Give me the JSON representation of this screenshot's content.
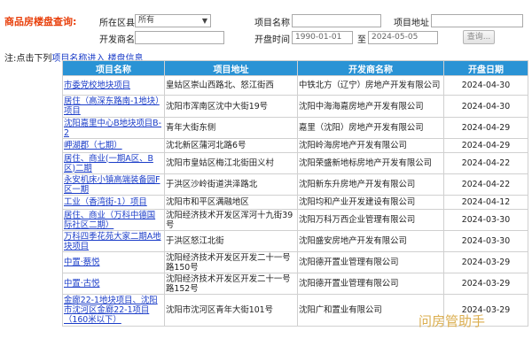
{
  "search": {
    "title": "商品房楼盘查询:",
    "district_label": "所在区县",
    "district_value": "所有",
    "project_name_label": "项目名称",
    "project_name_value": "",
    "project_addr_label": "项目地址",
    "project_addr_value": "",
    "developer_label": "开发商名",
    "developer_value": "",
    "open_time_label": "开盘时间",
    "date_from": "1990-01-01",
    "to_label": "至",
    "date_to": "2024-05-05",
    "query_button": "查询..."
  },
  "note": {
    "prefix": "注:点击下列",
    "link": "项目名称进入",
    "suffix": "楼盘信息"
  },
  "table": {
    "headers": [
      "项目名称",
      "项目地址",
      "开发商名称",
      "开盘日期"
    ],
    "rows": [
      {
        "name": "市委党校地块项目",
        "address": "皇姑区崇山西路北、怒江街西",
        "developer": "中铁北方（辽宁）房地产开发有限公司",
        "date": "2024-04-30"
      },
      {
        "name": "居住（高深东路南-1地块）项目",
        "address": "沈阳市浑南区沈中大街19号",
        "developer": "沈阳中海海嘉房地产开发有限公司",
        "date": "2024-04-30"
      },
      {
        "name": "沈阳嘉里中心B地块项目B-2",
        "address": "青年大街东侧",
        "developer": "嘉里（沈阳）房地产开发有限公司",
        "date": "2024-04-29"
      },
      {
        "name": "岬湖郡（七期）",
        "address": "沈北新区蒲河北路6号",
        "developer": "沈阳岭海房地产开发有限公司",
        "date": "2024-04-29"
      },
      {
        "name": "居住、商业(一期A区、B区)二期",
        "address": "沈阳市皇姑区梅江北街田义村",
        "developer": "沈阳荣盛新地标房地产开发有限公司",
        "date": "2024-04-22"
      },
      {
        "name": "永安机床小镇高端装备园F区一期",
        "address": "于洪区沙岭街道洪泽路北",
        "developer": "沈阳新东升房地产开发有限公司",
        "date": "2024-04-22"
      },
      {
        "name": "工业（香湾街-1）项目",
        "address": "沈阳市和平区满融地区",
        "developer": "沈阳均和产业开发建设有限公司",
        "date": "2024-04-12"
      },
      {
        "name": "居住、商业（万科中德国际社区二期）",
        "address": "沈阳经济技术开发区浑河十九街39号",
        "developer": "沈阳万科万西企业管理有限公司",
        "date": "2024-03-30"
      },
      {
        "name": "万科四季花苑大家二期A地块项目",
        "address": "于洪区怒江北街",
        "developer": "沈阳盛安房地产开发有限公司",
        "date": "2024-03-30"
      },
      {
        "name": "中置·蔡悦",
        "address": "沈阳经济技术开发区开发二十一号路150号",
        "developer": "沈阳德开置业管理有限公司",
        "date": "2024-03-29"
      },
      {
        "name": "中置·古悦",
        "address": "沈阳经济技术开发区开发二十一号路152号",
        "developer": "沈阳德开置业管理有限公司",
        "date": "2024-03-29"
      },
      {
        "name": "金廊22-1地块项目、沈阳市沈河区金廊22-1项目（160米以下）",
        "address": "沈阳市沈河区青年大街101号",
        "developer": "沈阳广和置业有限公司",
        "date": "2024-03-29"
      }
    ]
  },
  "watermark": "问房管助手",
  "colors": {
    "title": "#e8400c",
    "header_bg": "#2a93d5",
    "link": "#1a3cc8"
  }
}
